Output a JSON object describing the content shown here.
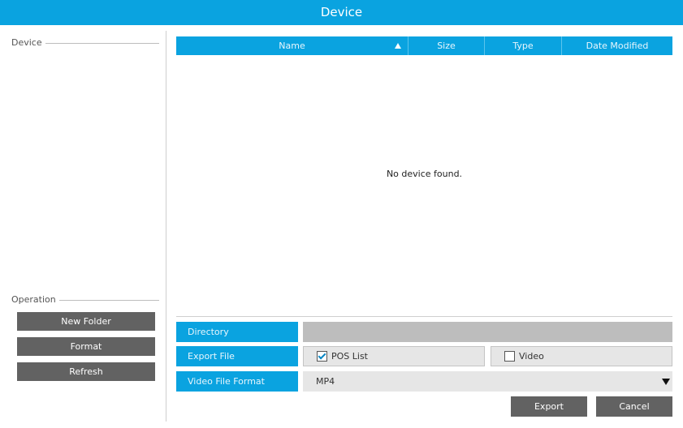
{
  "window": {
    "title": "Device"
  },
  "sidebar": {
    "device_group_label": "Device",
    "operation_group_label": "Operation",
    "buttons": [
      "New Folder",
      "Format",
      "Refresh"
    ]
  },
  "file_table": {
    "columns": [
      "Name",
      "Size",
      "Type",
      "Date Modified"
    ],
    "sort_column": "Name",
    "sort_direction": "ascending",
    "empty_message": "No device found."
  },
  "export_form": {
    "directory_label": "Directory",
    "directory_value": "",
    "export_file_label": "Export File",
    "pos_list_label": "POS List",
    "pos_list_checked": true,
    "video_label": "Video",
    "video_checked": false,
    "video_format_label": "Video File Format",
    "video_format_value": "MP4"
  },
  "actions": {
    "export": "Export",
    "cancel": "Cancel"
  },
  "colors": {
    "accent": "#0aa3e0",
    "button": "#626262",
    "field_bg": "#e6e6e6",
    "directory_bg": "#bdbdbd"
  }
}
